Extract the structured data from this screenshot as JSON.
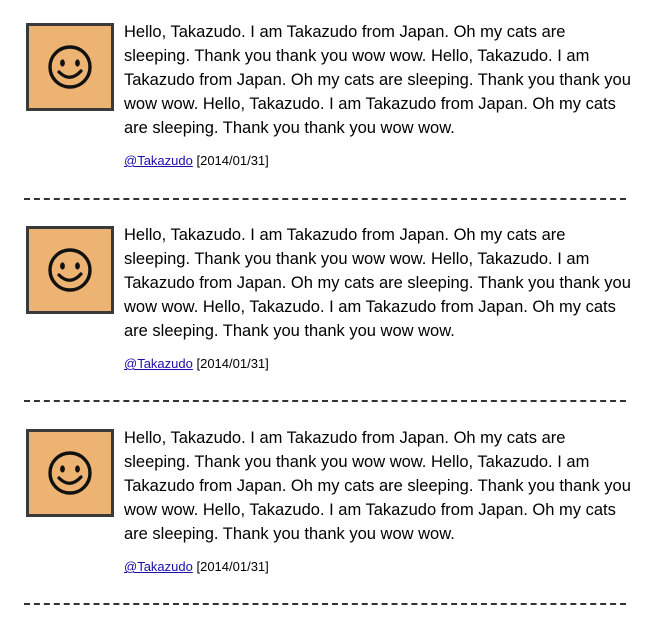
{
  "posts": [
    {
      "text": "Hello, Takazudo. I am Takazudo from Japan. Oh my cats are sleeping. Thank you thank you wow wow. Hello, Takazudo. I am Takazudo from Japan. Oh my cats are sleeping. Thank you thank you wow wow. Hello, Takazudo. I am Takazudo from Japan. Oh my cats are sleeping. Thank you thank you wow wow.",
      "user": "@Takazudo",
      "date": "[2014/01/31]",
      "avatar_icon": "smiley-face-icon"
    },
    {
      "text": "Hello, Takazudo. I am Takazudo from Japan. Oh my cats are sleeping. Thank you thank you wow wow. Hello, Takazudo. I am Takazudo from Japan. Oh my cats are sleeping. Thank you thank you wow wow. Hello, Takazudo. I am Takazudo from Japan. Oh my cats are sleeping. Thank you thank you wow wow.",
      "user": "@Takazudo",
      "date": "[2014/01/31]",
      "avatar_icon": "smiley-face-icon"
    },
    {
      "text": "Hello, Takazudo. I am Takazudo from Japan. Oh my cats are sleeping. Thank you thank you wow wow. Hello, Takazudo. I am Takazudo from Japan. Oh my cats are sleeping. Thank you thank you wow wow. Hello, Takazudo. I am Takazudo from Japan. Oh my cats are sleeping. Thank you thank you wow wow.",
      "user": "@Takazudo",
      "date": "[2014/01/31]",
      "avatar_icon": "smiley-face-icon"
    }
  ],
  "colors": {
    "avatar_bg": "#ecb372",
    "avatar_border": "#3a3a3a",
    "link": "#1a0dab",
    "divider": "#333333"
  }
}
